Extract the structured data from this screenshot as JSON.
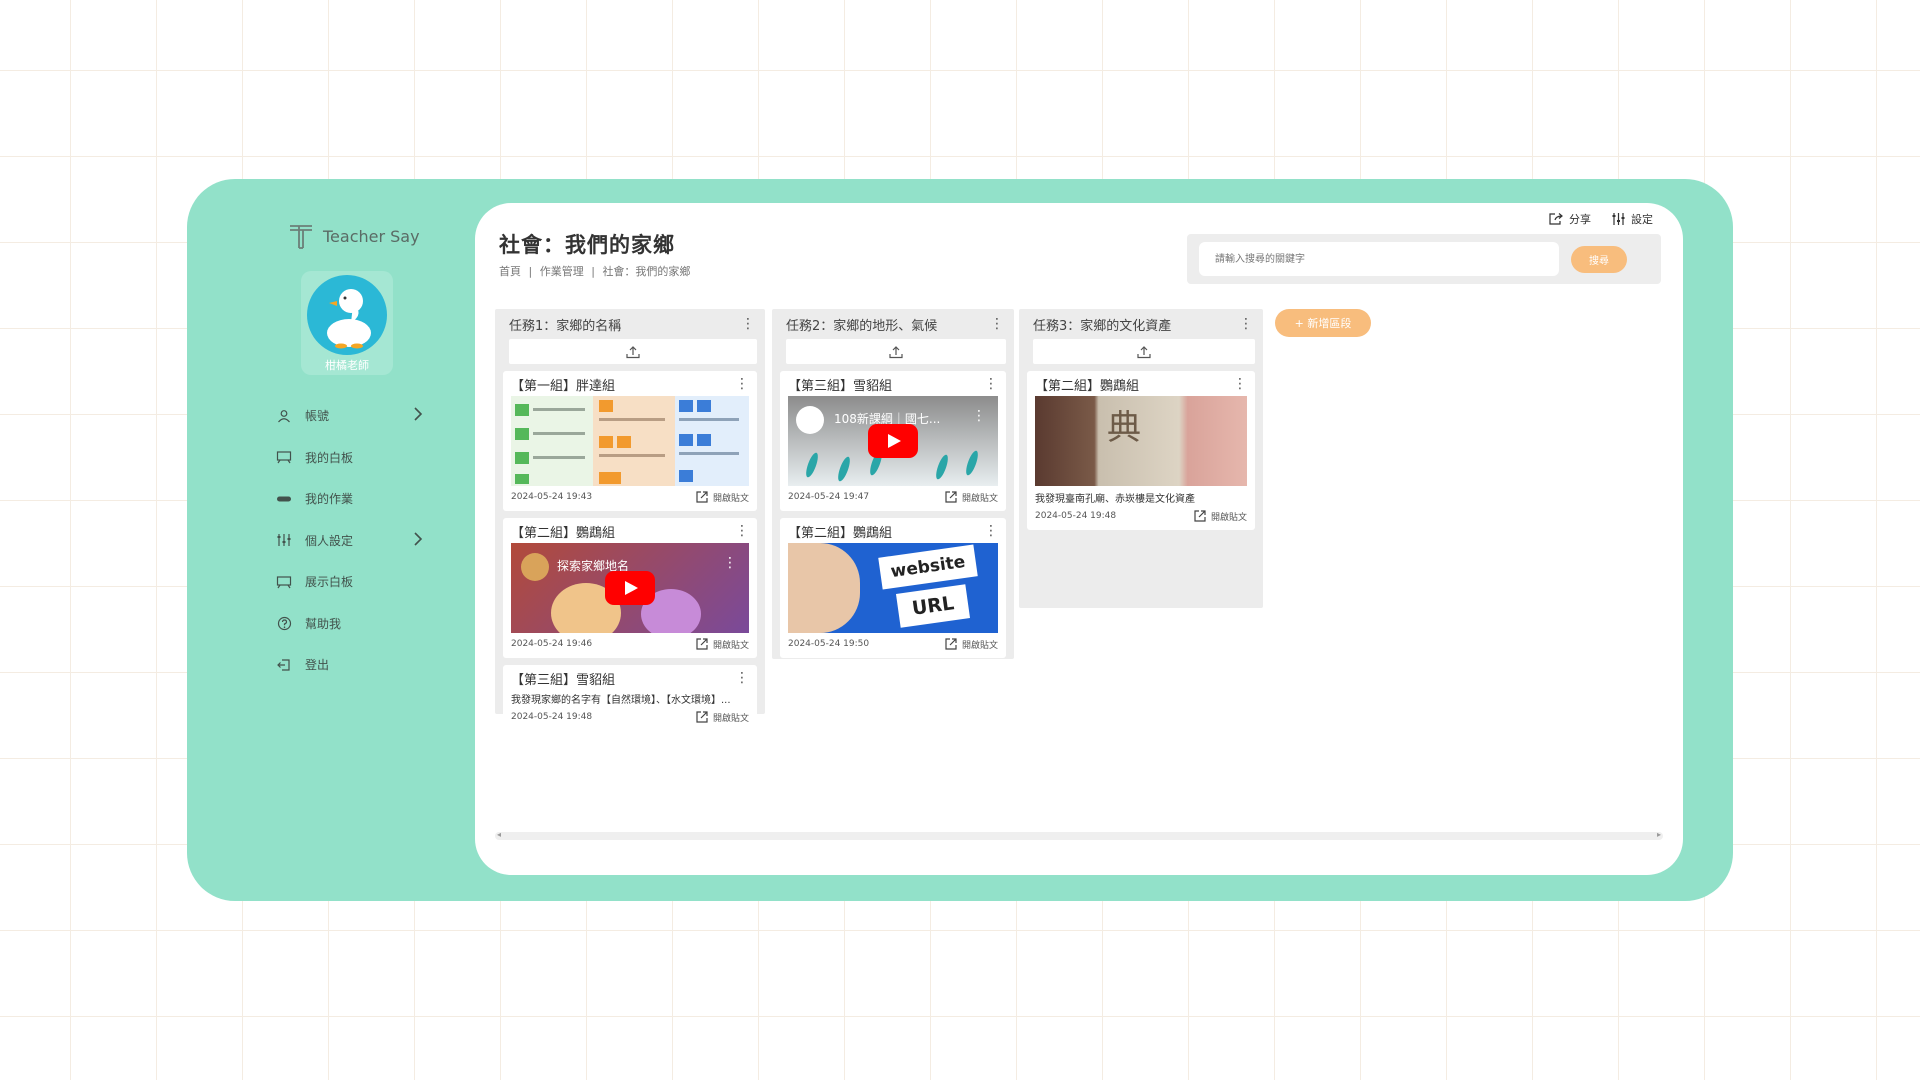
{
  "brand": {
    "name": "Teacher Say"
  },
  "user": {
    "name": "柑橘老師"
  },
  "sidebar": {
    "items": [
      {
        "label": "帳號",
        "icon": "user-icon",
        "chevron": true
      },
      {
        "label": "我的白板",
        "icon": "board-icon",
        "chevron": false
      },
      {
        "label": "我的作業",
        "icon": "homework-icon",
        "chevron": false
      },
      {
        "label": "個人設定",
        "icon": "sliders-icon",
        "chevron": true
      },
      {
        "label": "展示白板",
        "icon": "display-board-icon",
        "chevron": false
      },
      {
        "label": "幫助我",
        "icon": "help-icon",
        "chevron": false
      },
      {
        "label": "登出",
        "icon": "logout-icon",
        "chevron": false
      }
    ]
  },
  "header": {
    "title": "社會：我們的家鄉",
    "breadcrumb": [
      "首頁",
      "|",
      "作業管理",
      "|",
      "社會：我們的家鄉"
    ],
    "share_label": "分享",
    "settings_label": "設定",
    "search_placeholder": "請輸入搜尋的關鍵字",
    "search_button": "搜尋",
    "add_section_label": "+ 新增區段"
  },
  "columns": [
    {
      "title": "任務1：家鄉的名稱",
      "cards": [
        {
          "group": "【第一組】胖達組",
          "type": "image-slide",
          "time": "2024-05-24 19:43",
          "open": "開啟貼文"
        },
        {
          "group": "【第二組】鸚鵡組",
          "type": "video",
          "video_title": "探索家鄉地名",
          "time": "2024-05-24 19:46",
          "open": "開啟貼文"
        },
        {
          "group": "【第三組】雪貂組",
          "type": "text",
          "text": "我發現家鄉的名字有【自然環境】、【水文環境】...",
          "time": "2024-05-24 19:48",
          "open": "開啟貼文"
        }
      ]
    },
    {
      "title": "任務2：家鄉的地形、氣候",
      "cards": [
        {
          "group": "【第三組】雪貂組",
          "type": "video",
          "video_title": "108新課綱｜國七...",
          "time": "2024-05-24 19:47",
          "open": "開啟貼文"
        },
        {
          "group": "【第二組】鸚鵡組",
          "type": "url-image",
          "img_words": [
            "website",
            "URL"
          ],
          "time": "2024-05-24 19:50",
          "open": "開啟貼文"
        }
      ]
    },
    {
      "title": "任務3：家鄉的文化資產",
      "cards": [
        {
          "group": "【第二組】鸚鵡組",
          "type": "photo",
          "img_chars": "典",
          "text": "我發現臺南孔廟、赤崁樓是文化資產",
          "time": "2024-05-24 19:48",
          "open": "開啟貼文"
        }
      ]
    }
  ],
  "colors": {
    "frame": "#92e1c9",
    "accent": "#f8bd7d",
    "column": "#ececec"
  }
}
